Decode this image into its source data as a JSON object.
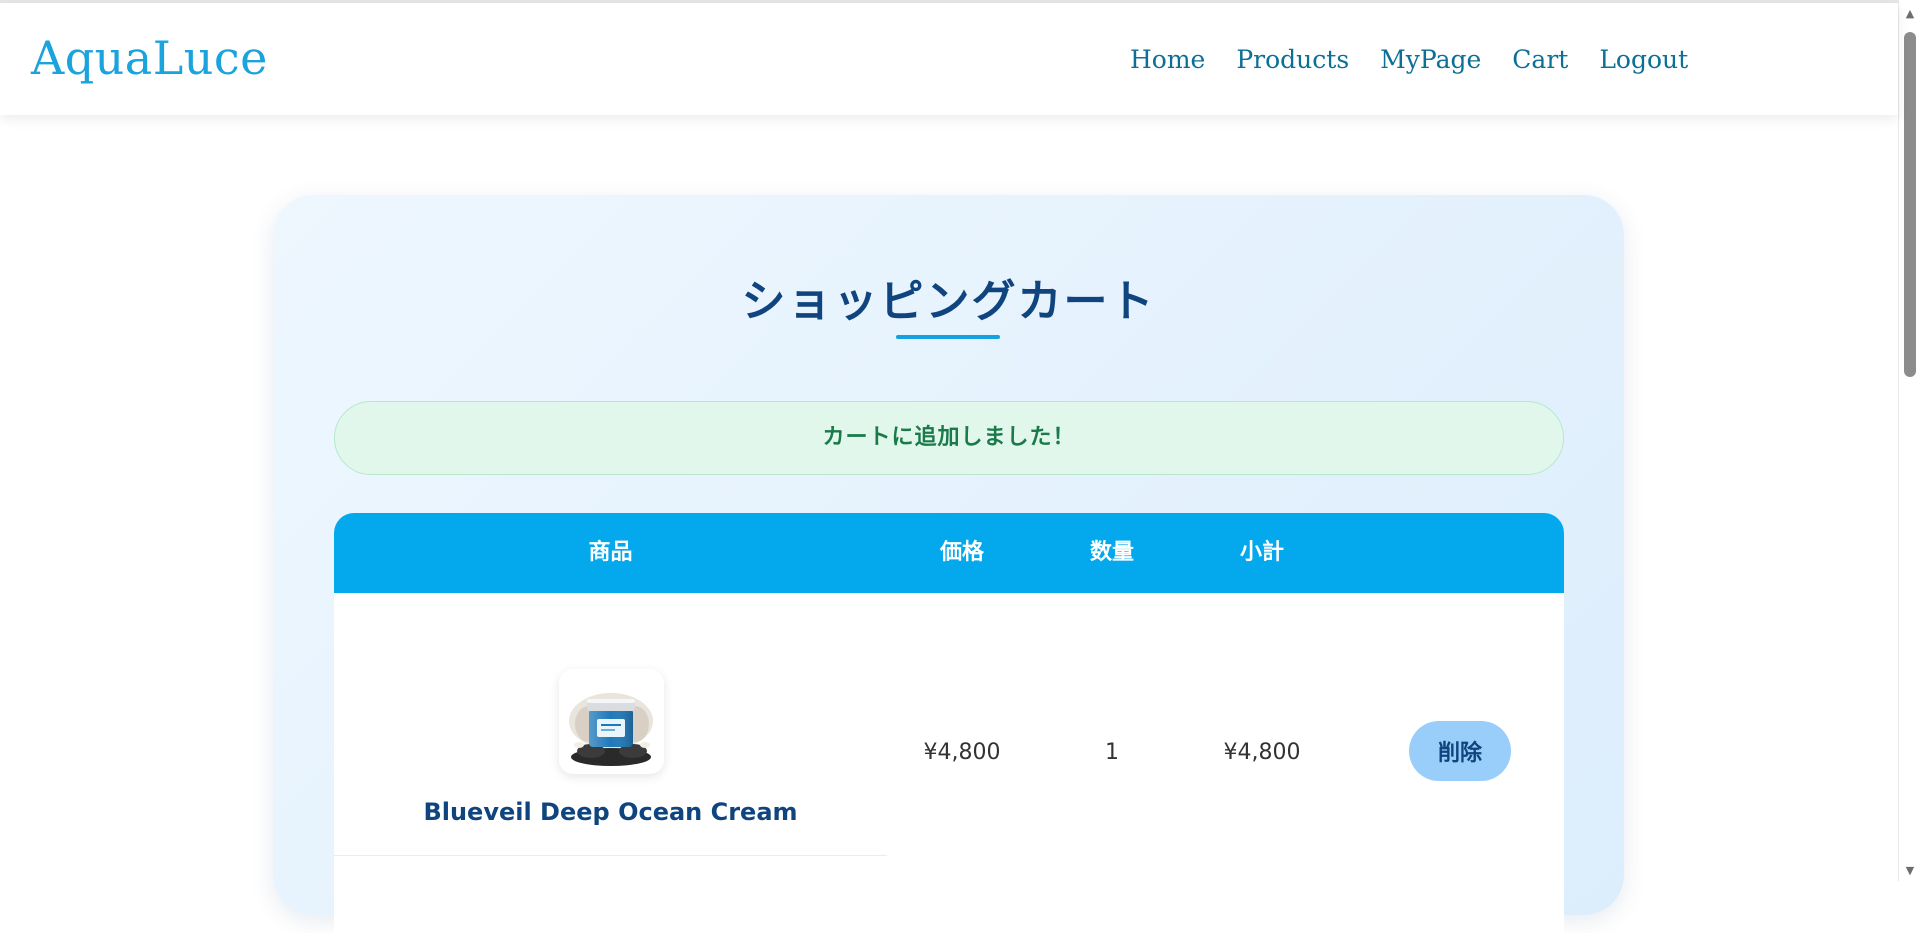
{
  "header": {
    "logo": "AquaLuce",
    "nav": {
      "home": "Home",
      "products": "Products",
      "mypage": "MyPage",
      "cart": "Cart",
      "logout": "Logout"
    }
  },
  "cart": {
    "title": "ショッピングカート",
    "alert": "カートに追加しました！",
    "columns": {
      "product": "商品",
      "price": "価格",
      "quantity": "数量",
      "subtotal": "小計"
    },
    "items": [
      {
        "name": "Blueveil Deep Ocean Cream",
        "price": "¥4,800",
        "quantity": "1",
        "subtotal": "¥4,800",
        "delete_label": "削除",
        "image_icon": "cream-jar-image"
      }
    ]
  },
  "colors": {
    "brand": "#1aa3dc",
    "nav_link": "#0b6f96",
    "table_header": "#03a9ec",
    "title": "#10447f",
    "alert_bg": "#e2f7ec",
    "alert_text": "#1a7a4a",
    "delete_button": "#99cdfa"
  }
}
